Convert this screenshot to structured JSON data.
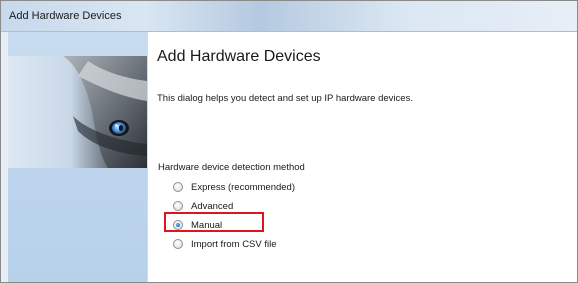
{
  "window": {
    "title": "Add Hardware Devices"
  },
  "main": {
    "heading": "Add Hardware Devices",
    "description": "This dialog helps you detect and set up IP hardware devices.",
    "detection_group": {
      "label": "Hardware device detection method",
      "options": [
        {
          "label": "Express (recommended)",
          "selected": false
        },
        {
          "label": "Advanced",
          "selected": false
        },
        {
          "label": "Manual",
          "selected": true
        },
        {
          "label": "Import from CSV file",
          "selected": false
        }
      ]
    }
  },
  "annotation": {
    "highlight_color": "#e0141e",
    "highlighted_option": "Manual"
  },
  "colors": {
    "titlebar": "#c7d9ec",
    "side_panel": "#bcd4ec"
  }
}
